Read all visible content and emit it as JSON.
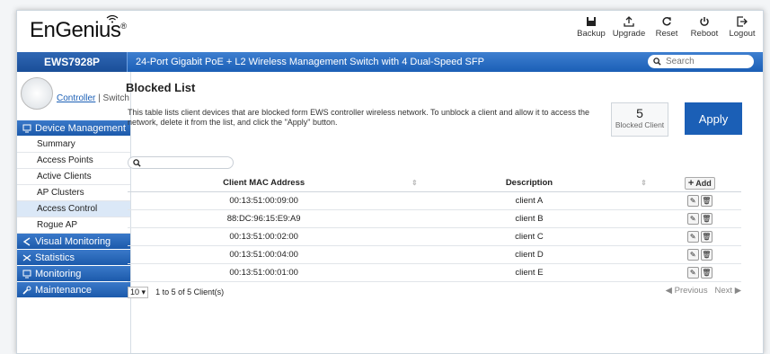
{
  "brand": {
    "logo": "EnGenius",
    "mark": "®"
  },
  "toolbar": [
    {
      "label": "Backup",
      "icon": "save-icon"
    },
    {
      "label": "Upgrade",
      "icon": "upload-icon"
    },
    {
      "label": "Reset",
      "icon": "reset-icon"
    },
    {
      "label": "Reboot",
      "icon": "power-icon"
    },
    {
      "label": "Logout",
      "icon": "logout-icon"
    }
  ],
  "header": {
    "model": "EWS7928P",
    "description": "24-Port Gigabit PoE + L2 Wireless Management Switch with 4 Dual-Speed SFP",
    "search_placeholder": "Search"
  },
  "mode": {
    "controller": "Controller",
    "separator": "|",
    "switch": "Switch"
  },
  "sidebar": {
    "device_management": "Device Management",
    "items": [
      "Summary",
      "Access Points",
      "Active Clients",
      "AP Clusters",
      "Access Control",
      "Rogue AP"
    ],
    "visual_monitoring": "Visual Monitoring",
    "statistics": "Statistics",
    "monitoring": "Monitoring",
    "maintenance": "Maintenance"
  },
  "main": {
    "title": "Blocked List",
    "intro": "This table lists client devices that are blocked form EWS controller wireless network. To unblock a client and allow it to access the network, delete it from the list, and click the \"Apply\" button.",
    "count": "5",
    "count_label": "Blocked Client",
    "apply": "Apply",
    "columns": [
      "Client MAC Address",
      "Description"
    ],
    "add_label": "Add",
    "rows": [
      {
        "mac": "00:13:51:00:09:00",
        "desc": "client A"
      },
      {
        "mac": "88:DC:96:15:E9:A9",
        "desc": "client B"
      },
      {
        "mac": "00:13:51:00:02:00",
        "desc": "client C"
      },
      {
        "mac": "00:13:51:00:04:00",
        "desc": "client D"
      },
      {
        "mac": "00:13:51:00:01:00",
        "desc": "client E"
      }
    ],
    "page_size": "10",
    "summary": "1 to 5 of 5 Client(s)",
    "previous": "Previous",
    "next": "Next"
  }
}
